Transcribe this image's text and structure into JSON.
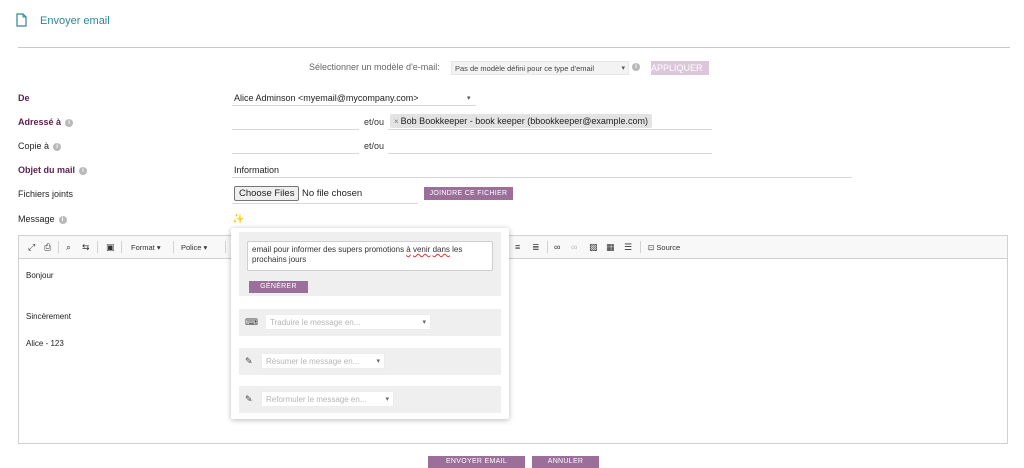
{
  "header": {
    "title": "Envoyer email",
    "icon": "document-icon"
  },
  "template": {
    "label": "Sélectionner un modèle d'e-mail:",
    "selected": "Pas de modèle défini pour ce type d'email",
    "apply_label": "APPLIQUER"
  },
  "form": {
    "from_label": "De",
    "from_value": "Alice Adminson <myemail@mycompany.com>",
    "to_label": "Adressé à",
    "and_or": "et/ou",
    "to_tag": "Bob Bookkeeper - book keeper (bbookkeeper@example.com)",
    "cc_label": "Copie à",
    "cc_and_or": "et/ou",
    "subject_label": "Objet du mail",
    "subject_value": "Information",
    "attachments_label": "Fichiers joints",
    "choose_files": "Choose Files",
    "no_file": "No file chosen",
    "attach_button": "JOINDRE CE FICHIER",
    "message_label": "Message"
  },
  "toolbar": {
    "format": "Format",
    "font": "Police",
    "source": "Source"
  },
  "message_body": {
    "line1": "Bonjour",
    "line2": "Sincèrement",
    "line3": "Alice - 123"
  },
  "ai_popup": {
    "prompt_pre": "email pour informer des supers promotions ",
    "prompt_w1": "à",
    "prompt_mid": " ",
    "prompt_w2": "venir",
    "prompt_mid2": " ",
    "prompt_w3": "dans",
    "prompt_mid3": " les ",
    "prompt_line2": "prochains jours",
    "generate": "GÉNÉRER",
    "translate_placeholder": "Traduire le message en...",
    "summarize_placeholder": "Résumer le message en...",
    "rephrase_placeholder": "Reformuler le message en..."
  },
  "actions": {
    "send": "ENVOYER EMAIL",
    "cancel": "ANNULER"
  },
  "colors": {
    "accent": "#9b6f99",
    "title": "#2a8a94",
    "required_label": "#5a1f4e"
  }
}
